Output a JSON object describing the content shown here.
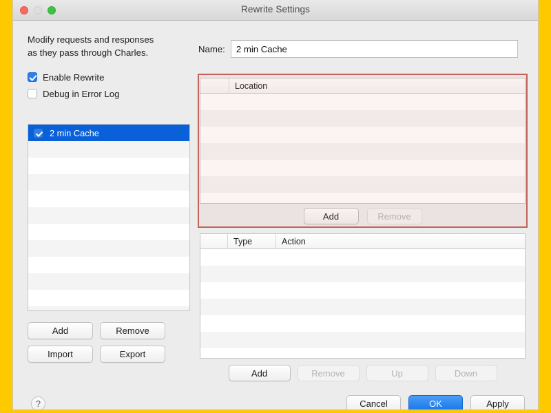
{
  "window": {
    "title": "Rewrite Settings",
    "traffic_lights": [
      "close-button",
      "minimize-button",
      "zoom-button"
    ]
  },
  "left_panel": {
    "blurb_line1": "Modify requests and responses",
    "blurb_line2": "as they pass through Charles.",
    "checkboxes": [
      {
        "label": "Enable Rewrite",
        "checked": true
      },
      {
        "label": "Debug in Error Log",
        "checked": false
      }
    ],
    "rules": [
      {
        "label": "2 min Cache",
        "checked": true,
        "selected": true
      }
    ],
    "empty_row_count": 11,
    "buttons": [
      {
        "label": "Add",
        "enabled": true
      },
      {
        "label": "Remove",
        "enabled": true
      },
      {
        "label": "Import",
        "enabled": true
      },
      {
        "label": "Export",
        "enabled": true
      }
    ]
  },
  "right_panel": {
    "name_label": "Name:",
    "name_value": "2 min Cache",
    "name_placeholder": "",
    "location_table": {
      "columns": [
        "",
        "Location"
      ],
      "rows": [],
      "empty_row_count": 7
    },
    "location_buttons": [
      {
        "label": "Add",
        "enabled": true
      },
      {
        "label": "Remove",
        "enabled": false
      }
    ],
    "action_table": {
      "columns": [
        "",
        "Type",
        "Action"
      ],
      "rows": [],
      "empty_row_count": 7
    },
    "action_buttons": [
      {
        "label": "Add",
        "enabled": true
      },
      {
        "label": "Remove",
        "enabled": false
      },
      {
        "label": "Up",
        "enabled": false
      },
      {
        "label": "Down",
        "enabled": false
      }
    ]
  },
  "footer": {
    "help_label": "?",
    "buttons": [
      {
        "label": "Cancel",
        "style": "normal"
      },
      {
        "label": "OK",
        "style": "default"
      },
      {
        "label": "Apply",
        "style": "normal"
      }
    ]
  },
  "annotation": {
    "highlight_color": "#c4615a",
    "target": "location-table-group"
  }
}
